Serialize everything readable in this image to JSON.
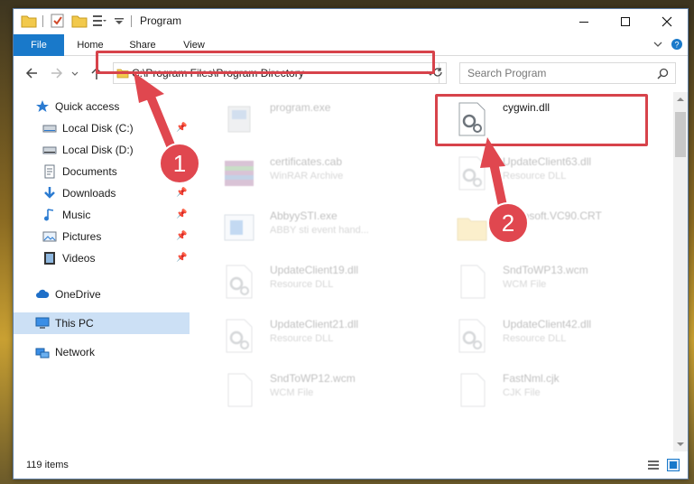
{
  "window": {
    "title": "Program",
    "controls": {
      "minimize": "—",
      "maximize": "☐",
      "close": "✕"
    }
  },
  "ribbon": {
    "tabs": [
      {
        "label": "File"
      },
      {
        "label": "Home"
      },
      {
        "label": "Share"
      },
      {
        "label": "View"
      }
    ]
  },
  "address": {
    "path": "C:\\Program Files\\Program Directory",
    "search_placeholder": "Search Program"
  },
  "sidebar": {
    "items": [
      {
        "label": "Quick access",
        "icon": "star-icon",
        "pinned": false
      },
      {
        "label": "Local Disk (C:)",
        "icon": "drive-icon",
        "pinned": true
      },
      {
        "label": "Local Disk (D:)",
        "icon": "drive-icon",
        "pinned": false
      },
      {
        "label": "Documents",
        "icon": "documents-icon",
        "pinned": false
      },
      {
        "label": "Downloads",
        "icon": "download-icon",
        "pinned": true
      },
      {
        "label": "Music",
        "icon": "music-icon",
        "pinned": true
      },
      {
        "label": "Pictures",
        "icon": "pictures-icon",
        "pinned": true
      },
      {
        "label": "Videos",
        "icon": "videos-icon",
        "pinned": true
      },
      {
        "label": "OneDrive",
        "icon": "cloud-icon",
        "pinned": false
      },
      {
        "label": "This PC",
        "icon": "computer-icon",
        "pinned": false,
        "selected": true
      },
      {
        "label": "Network",
        "icon": "network-icon",
        "pinned": false
      }
    ]
  },
  "files": [
    {
      "name": "program.exe",
      "type": "",
      "icon": "exe-icon",
      "faded": true
    },
    {
      "name": "cygwin.dll",
      "type": "",
      "icon": "dll-gear-icon",
      "faded": false
    },
    {
      "name": "certificates.cab",
      "type": "WinRAR Archive",
      "icon": "winrar-icon",
      "faded": true
    },
    {
      "name": "UpdateClient63.dll",
      "type": "Resource DLL",
      "icon": "dll-gear-icon",
      "faded": true
    },
    {
      "name": "AbbyySTI.exe",
      "type": "ABBY sti event hand...",
      "icon": "app-icon",
      "faded": true
    },
    {
      "name": "Microsoft.VC90.CRT",
      "type": "",
      "icon": "folder-icon",
      "faded": true
    },
    {
      "name": "UpdateClient19.dll",
      "type": "Resource DLL",
      "icon": "dll-gear-icon",
      "faded": true
    },
    {
      "name": "SndToWP13.wcm",
      "type": "WCM File",
      "icon": "file-icon",
      "faded": true
    },
    {
      "name": "UpdateClient21.dll",
      "type": "Resource DLL",
      "icon": "dll-gear-icon",
      "faded": true
    },
    {
      "name": "UpdateClient42.dll",
      "type": "Resource DLL",
      "icon": "dll-gear-icon",
      "faded": true
    },
    {
      "name": "SndToWP12.wcm",
      "type": "WCM File",
      "icon": "file-icon",
      "faded": true
    },
    {
      "name": "FastNml.cjk",
      "type": "CJK File",
      "icon": "file-icon",
      "faded": true
    }
  ],
  "status": {
    "item_count": "119 items"
  },
  "callouts": [
    {
      "number": "1"
    },
    {
      "number": "2"
    }
  ],
  "colors": {
    "accent": "#1979ca",
    "highlight": "#d7434b",
    "selected": "#cce0f5"
  }
}
